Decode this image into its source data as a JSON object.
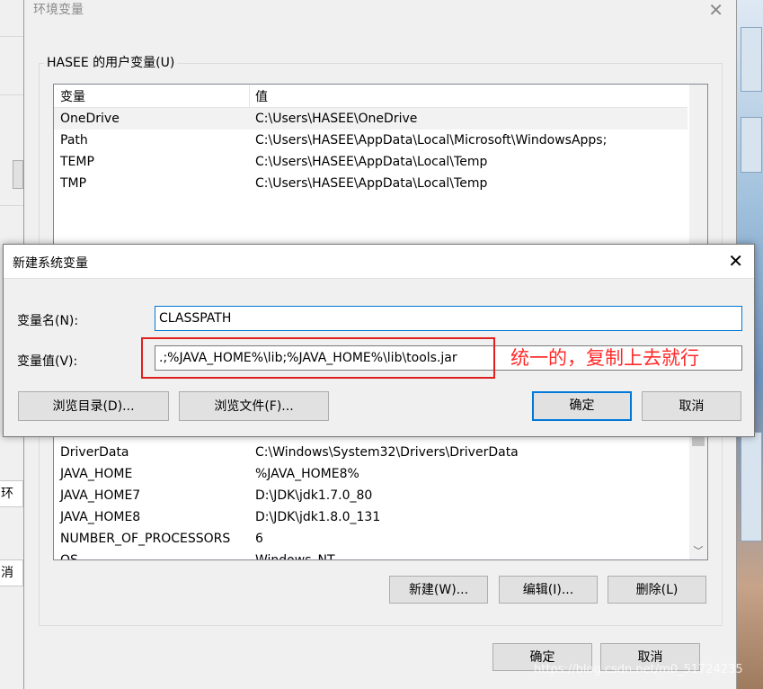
{
  "env_dialog": {
    "title": "环境变量",
    "user_group_label": "HASEE 的用户变量(U)",
    "columns": [
      "变量",
      "值"
    ],
    "user_vars": [
      {
        "name": "OneDrive",
        "value": "C:\\Users\\HASEE\\OneDrive"
      },
      {
        "name": "Path",
        "value": "C:\\Users\\HASEE\\AppData\\Local\\Microsoft\\WindowsApps;"
      },
      {
        "name": "TEMP",
        "value": "C:\\Users\\HASEE\\AppData\\Local\\Temp"
      },
      {
        "name": "TMP",
        "value": "C:\\Users\\HASEE\\AppData\\Local\\Temp"
      }
    ],
    "system_vars": [
      {
        "name": "DriverData",
        "value": "C:\\Windows\\System32\\Drivers\\DriverData"
      },
      {
        "name": "JAVA_HOME",
        "value": "%JAVA_HOME8%"
      },
      {
        "name": "JAVA_HOME7",
        "value": "D:\\JDK\\jdk1.7.0_80"
      },
      {
        "name": "JAVA_HOME8",
        "value": "D:\\JDK\\jdk1.8.0_131"
      },
      {
        "name": "NUMBER_OF_PROCESSORS",
        "value": "6"
      },
      {
        "name": "OS",
        "value": "Windows_NT"
      }
    ],
    "system_buttons": {
      "new": "新建(W)...",
      "edit": "编辑(I)...",
      "delete": "删除(L)"
    },
    "ok": "确定",
    "cancel": "取消"
  },
  "new_var_dialog": {
    "title": "新建系统变量",
    "name_label": "变量名(N):",
    "name_value": "CLASSPATH",
    "value_label": "变量值(V):",
    "value_value": ".;%JAVA_HOME%\\lib;%JAVA_HOME%\\lib\\tools.jar",
    "browse_dir": "浏览目录(D)...",
    "browse_file": "浏览文件(F)...",
    "ok": "确定",
    "cancel": "取消"
  },
  "annotation": "统一的，复制上去就行",
  "background_fragments": {
    "left_label1": "环境",
    "left_label2": "消"
  },
  "watermark": "https://blog.csdn.net/m0_51724235",
  "colors": {
    "annotation": "#ff2a2a",
    "focus": "#0078d7",
    "dialog_bg": "#f0f0f0"
  }
}
